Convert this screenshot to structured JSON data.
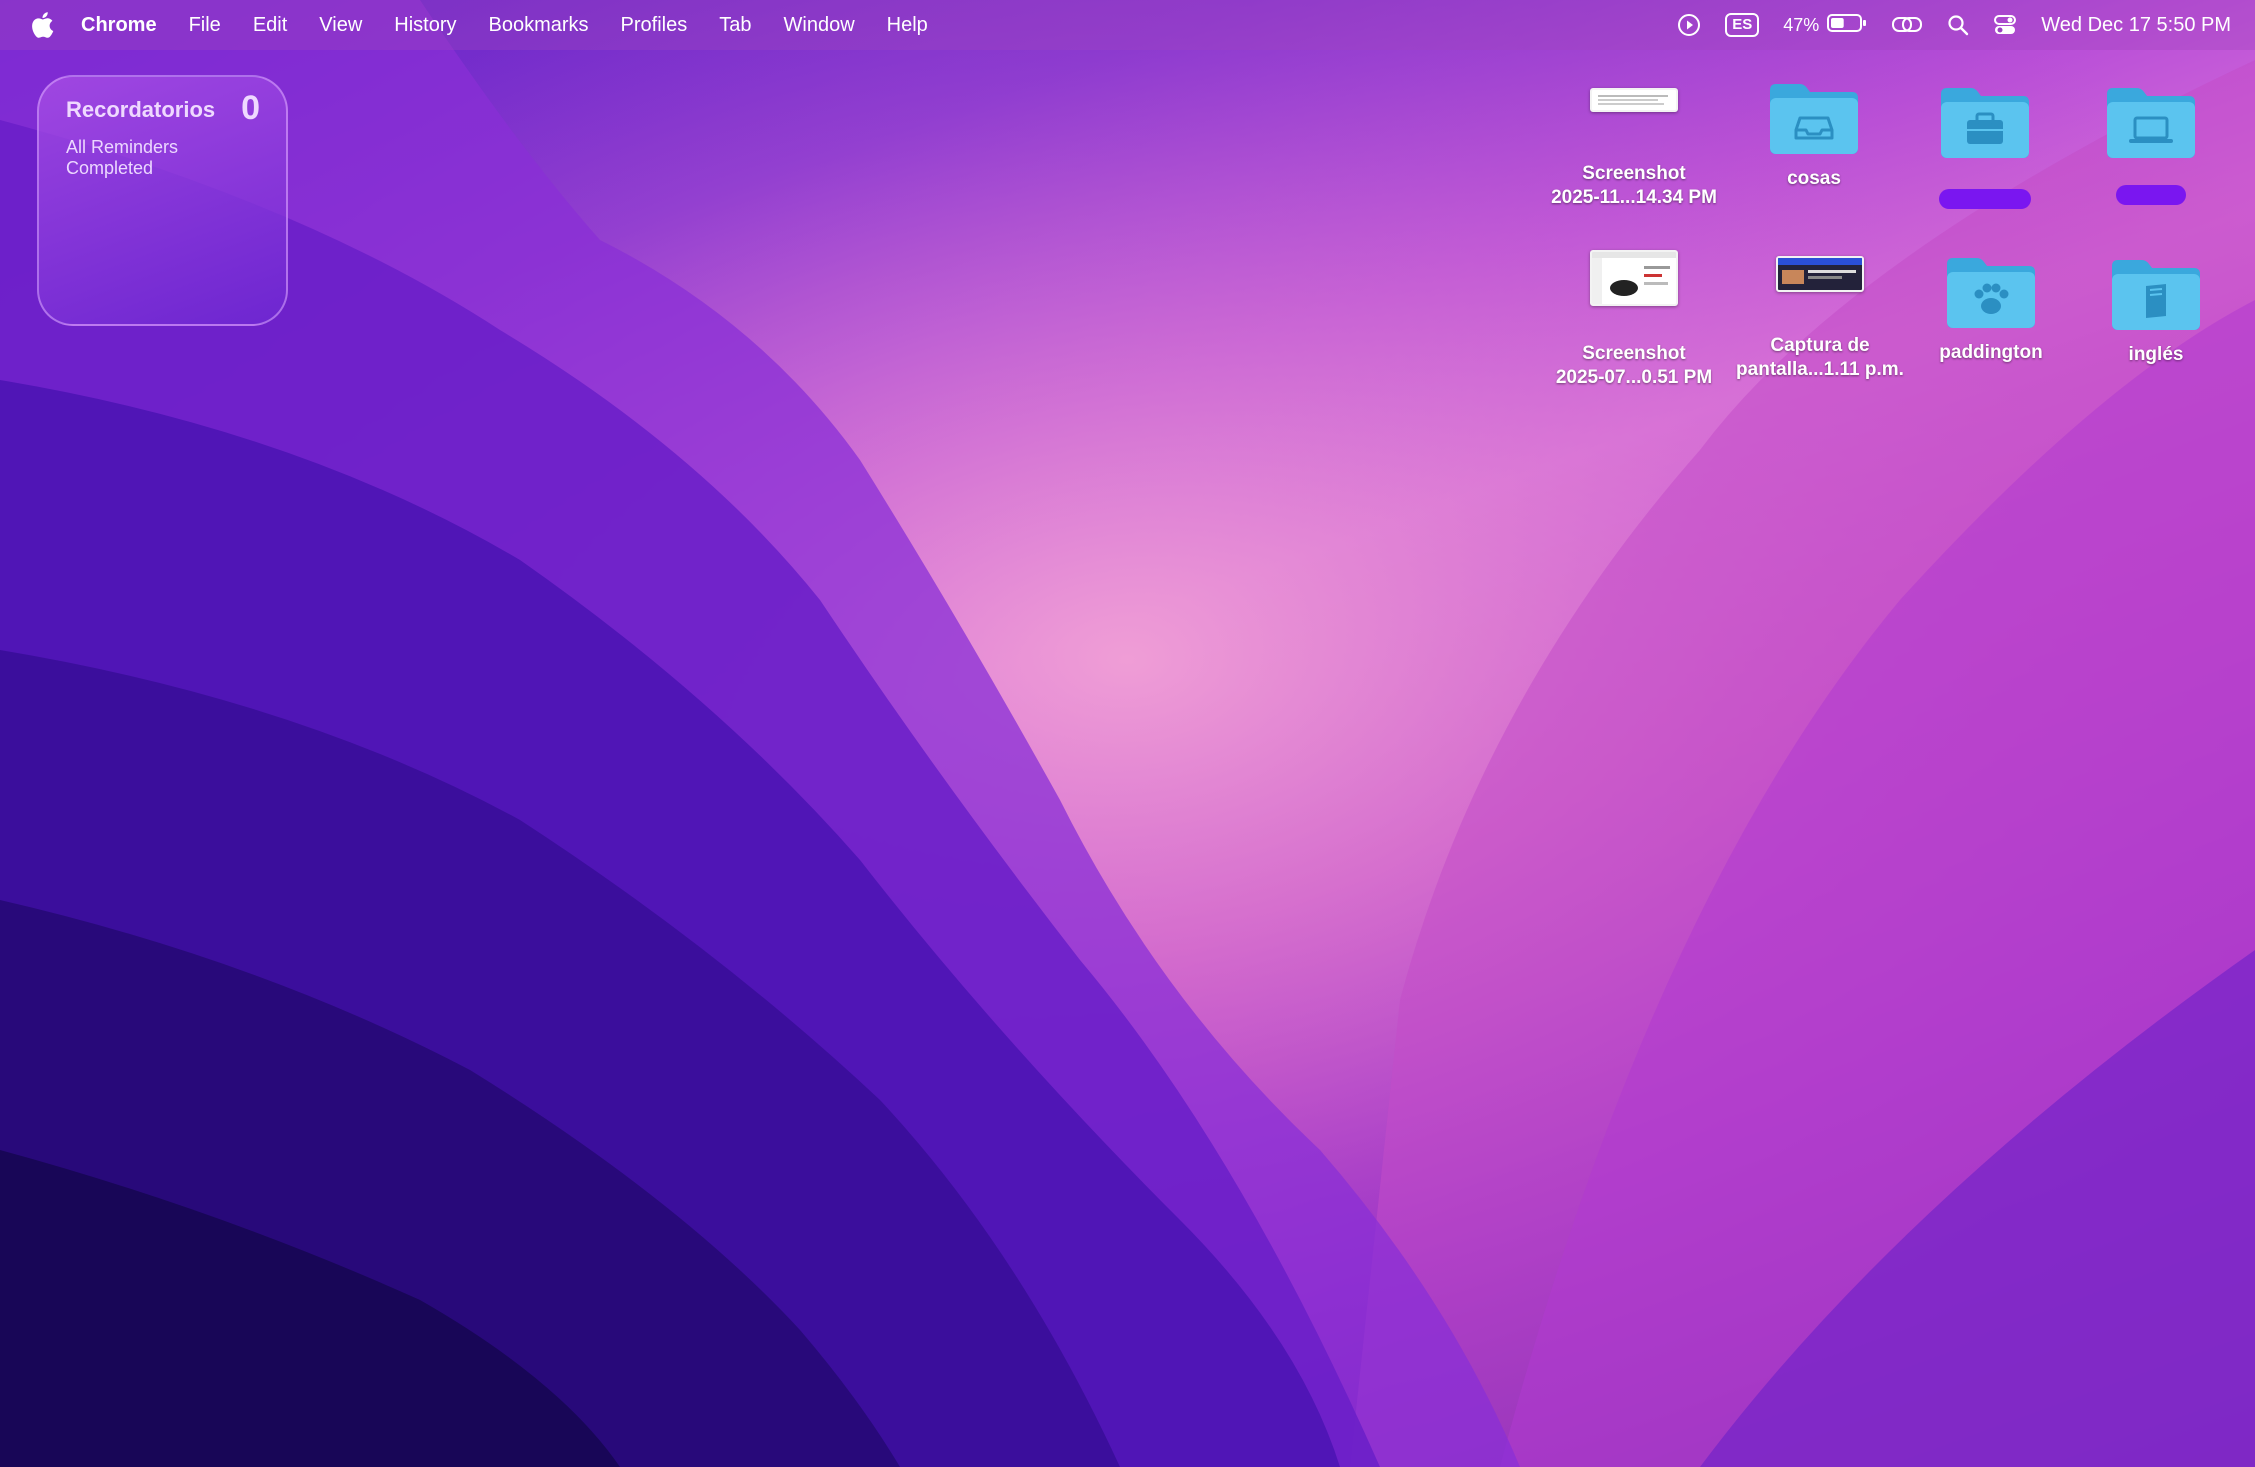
{
  "menubar": {
    "apple_icon": "apple-logo-icon",
    "app_name": "Chrome",
    "menus": [
      "File",
      "Edit",
      "View",
      "History",
      "Bookmarks",
      "Profiles",
      "Tab",
      "Window",
      "Help"
    ],
    "status": {
      "input_source": "ES",
      "battery_percent": "47%",
      "battery_level": 0.47,
      "clock": "Wed Dec 17  5:50 PM"
    }
  },
  "widget": {
    "title": "Recordatorios",
    "count": "0",
    "status": "All Reminders Completed"
  },
  "desktop_icons": [
    {
      "kind": "screenshot",
      "label_line1": "Screenshot",
      "label_line2": "2025-11...14.34 PM"
    },
    {
      "kind": "folder",
      "glyph": "tray-icon",
      "label_line1": "cosas",
      "label_line2": ""
    },
    {
      "kind": "folder",
      "glyph": "briefcase-icon",
      "label_line1": "",
      "label_line2": ""
    },
    {
      "kind": "folder",
      "glyph": "laptop-icon",
      "label_line1": "",
      "label_line2": ""
    },
    {
      "kind": "screenshot",
      "label_line1": "Screenshot",
      "label_line2": "2025-07...0.51 PM"
    },
    {
      "kind": "screenshot",
      "label_line1": "Captura de",
      "label_line2": "pantalla...1.11 p.m."
    },
    {
      "kind": "folder",
      "glyph": "paw-icon",
      "label_line1": "paddington",
      "label_line2": ""
    },
    {
      "kind": "folder",
      "glyph": "book-icon",
      "label_line1": "inglés",
      "label_line2": ""
    }
  ],
  "colors": {
    "folder_blue": "#5bc4ef",
    "folder_blue_dark": "#3aa8dd",
    "redaction_purple": "#7a16f0"
  }
}
